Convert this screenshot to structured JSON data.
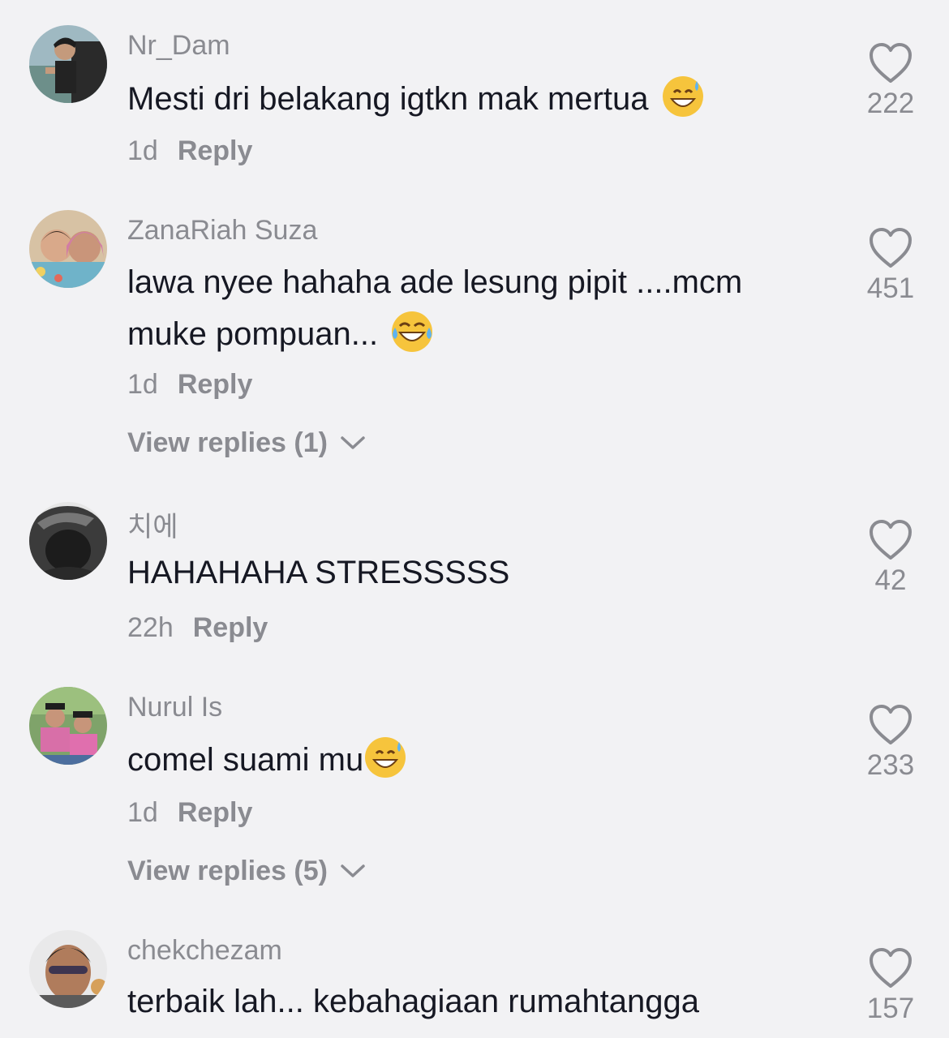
{
  "comments": [
    {
      "username": "Nr_Dam",
      "text": "Mesti dri belakang igtkn mak mertua",
      "emoji": "sweat-smile-emoji",
      "time": "1d",
      "reply_label": "Reply",
      "likes": "222"
    },
    {
      "username": "ZanaRiah Suza",
      "text": "lawa nyee hahaha ade lesung pipit ....mcm muke pompuan...",
      "emoji": "tears-of-joy-emoji",
      "time": "1d",
      "reply_label": "Reply",
      "view_replies": "View replies (1)",
      "likes": "451"
    },
    {
      "username": "치에",
      "text": "HAHAHAHA STRESSSSS",
      "time": "22h",
      "reply_label": "Reply",
      "likes": "42"
    },
    {
      "username": "Nurul Is",
      "text": "comel suami mu",
      "emoji": "sweat-smile-emoji",
      "time": "1d",
      "reply_label": "Reply",
      "view_replies": "View replies (5)",
      "likes": "233"
    },
    {
      "username": "chekchezam",
      "text": "terbaik lah... kebahagiaan rumahtangga",
      "likes": "157"
    }
  ],
  "colors": {
    "background": "#f2f2f4",
    "text": "#161823",
    "secondary": "#8a8b91"
  }
}
